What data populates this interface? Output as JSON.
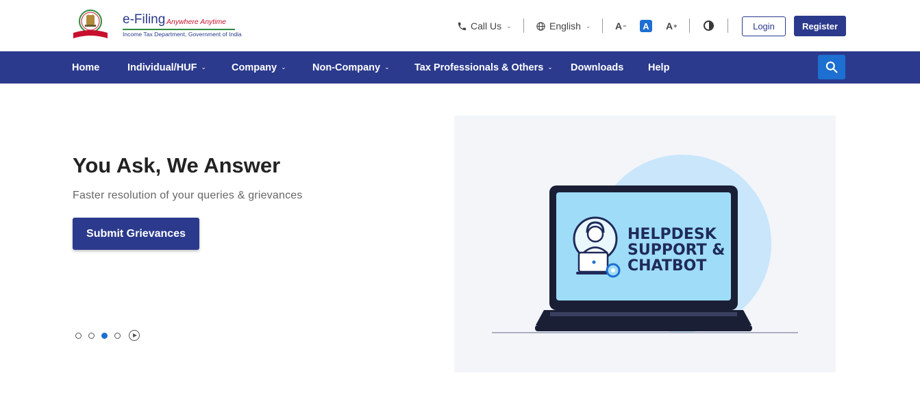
{
  "header": {
    "logo": {
      "title": "e-Filing",
      "tagline": "Anywhere Anytime",
      "subtitle": "Income Tax Department, Government of India"
    },
    "call_us": {
      "label": "Call Us",
      "icon": "phone-icon"
    },
    "language": {
      "label": "English",
      "icon": "globe-icon"
    },
    "font_controls": {
      "decrease": "A",
      "normal": "A",
      "increase": "A"
    },
    "contrast_icon": "contrast-icon",
    "login_label": "Login",
    "register_label": "Register"
  },
  "nav": {
    "items": [
      {
        "label": "Home",
        "dropdown": false
      },
      {
        "label": "Individual/HUF",
        "dropdown": true
      },
      {
        "label": "Company",
        "dropdown": true
      },
      {
        "label": "Non-Company",
        "dropdown": true
      },
      {
        "label": "Tax Professionals & Others",
        "dropdown": true
      },
      {
        "label": "Downloads",
        "dropdown": false
      },
      {
        "label": "Help",
        "dropdown": false
      }
    ],
    "search_icon": "search-icon"
  },
  "hero": {
    "title": "You Ask, We Answer",
    "subtitle": "Faster resolution of your queries & grievances",
    "button_label": "Submit Grievances",
    "slides_total": 4,
    "active_slide": 3,
    "illustration_lines": [
      "HELPDESK",
      "SUPPORT &",
      "CHATBOT"
    ]
  },
  "colors": {
    "primary": "#2b3a8c",
    "accent": "#1d6fd1",
    "screen": "#9fdcf7",
    "circle": "#c9e6fb"
  }
}
